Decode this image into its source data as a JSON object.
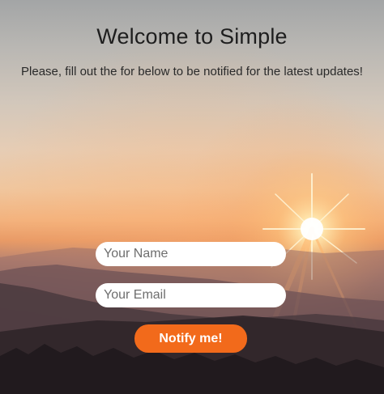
{
  "header": {
    "title": "Welcome to Simple",
    "subtitle": "Please, fill out the for below to be notified for the latest updates!"
  },
  "form": {
    "name_placeholder": "Your Name",
    "email_placeholder": "Your Email",
    "submit_label": "Notify me!"
  },
  "colors": {
    "accent": "#f26a1b",
    "title_text": "#1e1e1e"
  }
}
